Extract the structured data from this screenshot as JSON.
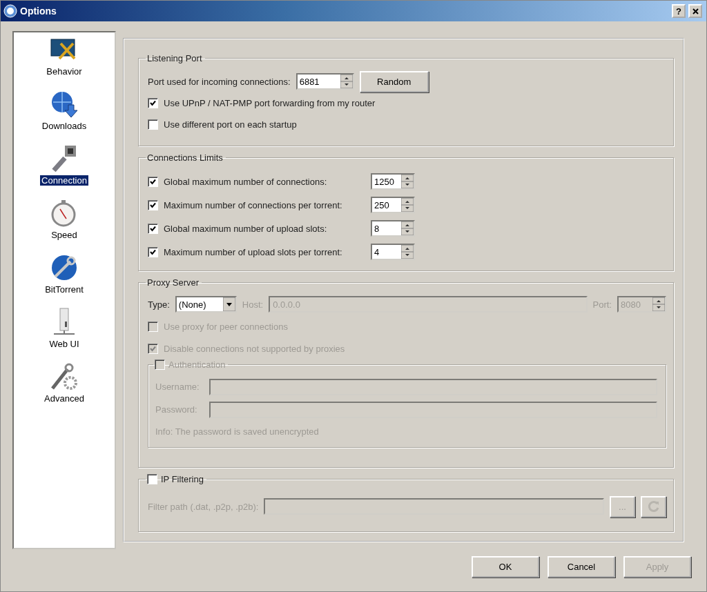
{
  "window": {
    "title": "Options",
    "help": "?"
  },
  "sidebar": {
    "items": [
      {
        "label": "Behavior",
        "kind": "behavior",
        "selected": false
      },
      {
        "label": "Downloads",
        "kind": "downloads",
        "selected": false
      },
      {
        "label": "Connection",
        "kind": "connection",
        "selected": true
      },
      {
        "label": "Speed",
        "kind": "speed",
        "selected": false
      },
      {
        "label": "BitTorrent",
        "kind": "bittorrent",
        "selected": false
      },
      {
        "label": "Web UI",
        "kind": "webui",
        "selected": false
      },
      {
        "label": "Advanced",
        "kind": "advanced",
        "selected": false
      }
    ]
  },
  "listening_port": {
    "title": "Listening Port",
    "port_label": "Port used for incoming connections:",
    "port_value": "6881",
    "random_button": "Random",
    "options": [
      {
        "label": "Use UPnP / NAT-PMP port forwarding from my router",
        "checked": true
      },
      {
        "label": "Use different port on each startup",
        "checked": false
      }
    ]
  },
  "connections_limits": {
    "title": "Connections Limits",
    "rows": [
      {
        "label": "Global maximum number of connections:",
        "checked": true,
        "value": "1250"
      },
      {
        "label": "Maximum number of connections per torrent:",
        "checked": true,
        "value": "250"
      },
      {
        "label": "Global maximum number of upload slots:",
        "checked": true,
        "value": "8"
      },
      {
        "label": "Maximum number of upload slots per torrent:",
        "checked": true,
        "value": "4"
      }
    ]
  },
  "proxy_server": {
    "title": "Proxy Server",
    "disabled": true,
    "type_label": "Type:",
    "type_value": "(None)",
    "host_label": "Host:",
    "host_value": "0.0.0.0",
    "port_label": "Port:",
    "port_value": "8080",
    "options": [
      {
        "label": "Use proxy for peer connections",
        "checked": false
      },
      {
        "label": "Disable connections not supported by proxies",
        "checked": true
      }
    ],
    "authentication": {
      "label": "Authentication",
      "checked": false,
      "username_label": "Username:",
      "password_label": "Password:",
      "info": "Info: The password is saved unencrypted"
    }
  },
  "ip_filtering": {
    "label": "IP Filtering",
    "checked": false,
    "path_label": "Filter path (.dat, .p2p, .p2b):",
    "browse_button": "..."
  },
  "buttons": [
    {
      "label": "OK",
      "disabled": false
    },
    {
      "label": "Cancel",
      "disabled": false
    },
    {
      "label": "Apply",
      "disabled": true
    }
  ]
}
